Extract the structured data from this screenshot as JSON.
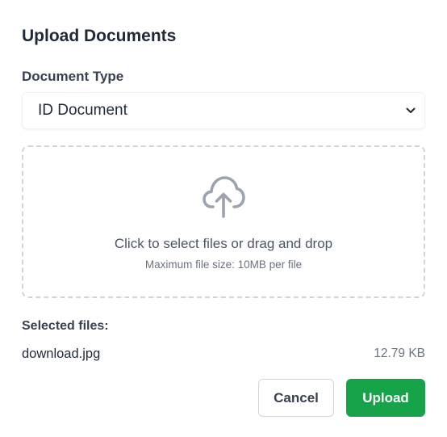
{
  "dialog": {
    "title": "Upload Documents"
  },
  "document_type": {
    "label": "Document Type",
    "selected": "ID Document",
    "chevron_icon": "chevron-down-icon"
  },
  "dropzone": {
    "icon": "cloud-upload-icon",
    "primary_text": "Click to select files or drag and drop",
    "secondary_text": "Maximum file size: 10MB per file"
  },
  "selected_files": {
    "label": "Selected files:",
    "items": [
      {
        "name": "download.jpg",
        "size": "12.79 KB"
      }
    ]
  },
  "actions": {
    "cancel_label": "Cancel",
    "upload_label": "Upload"
  },
  "colors": {
    "primary": "#16a34a",
    "dropzone_border": "#d1d5db",
    "icon": "#9ca3af"
  }
}
